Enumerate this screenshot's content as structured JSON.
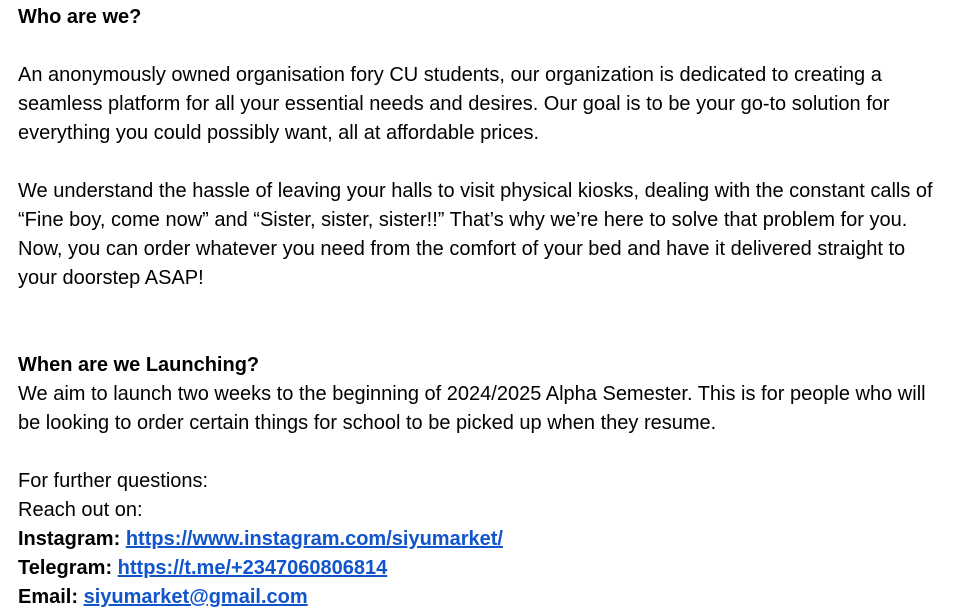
{
  "section1": {
    "heading": "Who are we?",
    "para1": "An anonymously owned organisation fory CU students, our organization is dedicated to creating a seamless platform for all your essential needs and desires. Our goal is to be your go-to solution for everything you could possibly want, all at affordable prices.",
    "para2": "We understand the hassle of leaving your halls to visit physical kiosks, dealing with the constant calls of “Fine boy, come now” and “Sister, sister, sister!!” That’s why we’re here to solve that problem for you. Now, you can order whatever you need from the comfort of your bed and have it delivered straight to your doorstep ASAP!"
  },
  "section2": {
    "heading": "When are we Launching?",
    "para": "We aim to launch two weeks to the beginning of 2024/2025 Alpha Semester. This is for people who will be looking to order certain things for school to be picked up when they resume."
  },
  "contact": {
    "intro1": "For further questions:",
    "intro2": "Reach out on:",
    "instagram_label": "Instagram:",
    "instagram_url": "https://www.instagram.com/siyumarket/",
    "telegram_label": "Telegram:",
    "telegram_url": "https://t.me/+2347060806814",
    "email_label": "Email:",
    "email_value": "siyumarket@gmail.com"
  },
  "colors": {
    "link": "#1155cc",
    "text": "#000000"
  }
}
